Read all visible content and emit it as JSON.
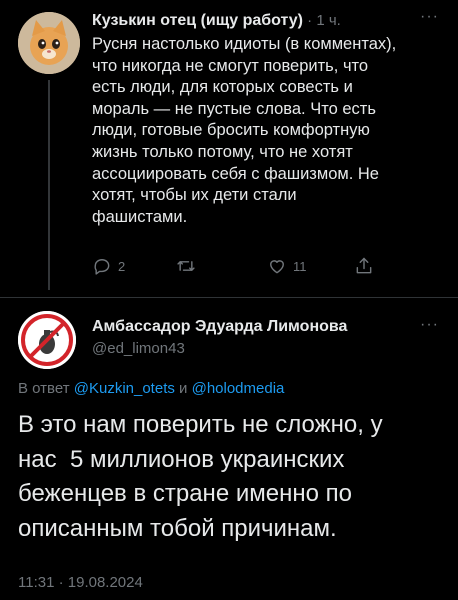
{
  "tweet": {
    "author_name": "Кузькин отец (ищу работу)",
    "separator": " · ",
    "time": "1 ч.",
    "more": "···",
    "lines": [
      "Русня настолько идиоты (в комментах),",
      "что никогда не смогут поверить, что",
      "есть люди, для которых совесть и",
      "мораль — не пустые слова. Что есть",
      "люди, готовые бросить комфортную",
      "жизнь только потому, что не хотят",
      "ассоциировать себя с фашизмом. Не",
      "хотят, чтобы их дети стали",
      "фашистами."
    ],
    "actions": {
      "replies": "2",
      "retweets": "",
      "likes": "11"
    }
  },
  "reply": {
    "author_name": "Амбассадор Эдуарда Лимонова",
    "handle": "@ed_limon43",
    "more": "···",
    "reply_prefix": "В ответ ",
    "mention1": "@Kuzkin_otets",
    "conj": " и ",
    "mention2": "@holodmedia",
    "lines": [
      "В это нам поверить не сложно, у",
      "нас  5 миллионов украинских",
      "беженцев в стране именно по",
      "описанным тобой причинам."
    ],
    "timestamp": "11:31 · 19.08.2024"
  },
  "icons": {
    "reply": "reply-icon",
    "retweet": "retweet-icon",
    "like": "heart-icon",
    "share": "share-icon"
  },
  "colors": {
    "background": "#000000",
    "text": "#e7e9ea",
    "muted": "#71767b",
    "link": "#1d9bf0"
  }
}
